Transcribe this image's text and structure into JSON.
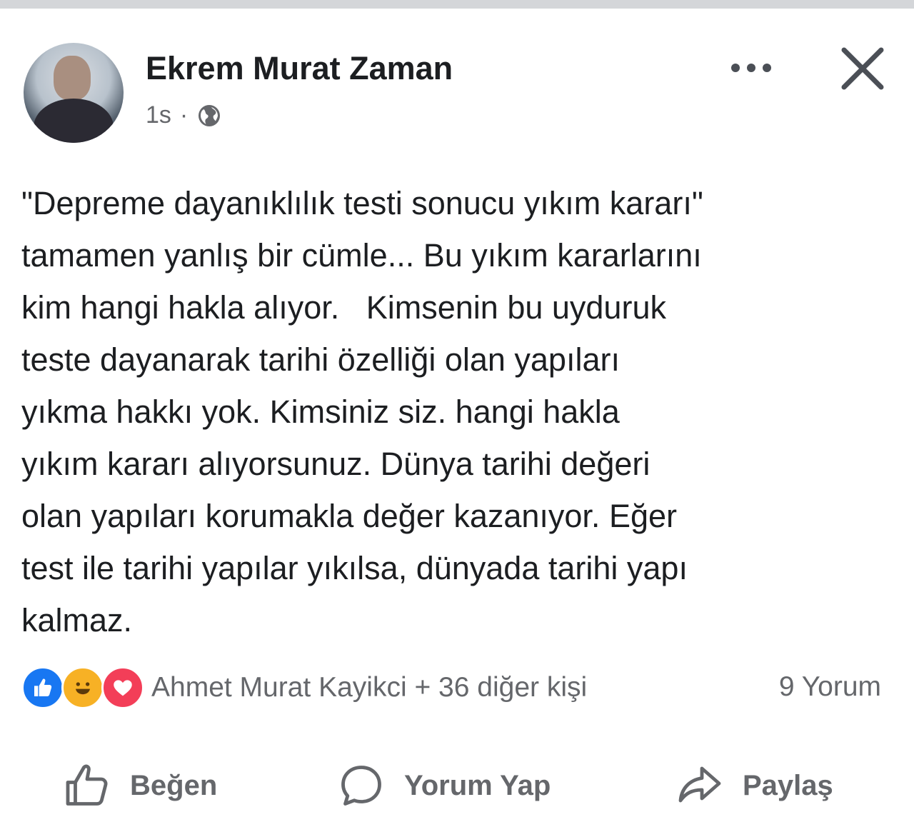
{
  "post": {
    "author": "Ekrem Murat Zaman",
    "time": "1s",
    "separator": "·",
    "text_lines": [
      "\"Depreme dayanıklılık testi sonucu yıkım kararı\"",
      "tamamen yanlış bir cümle... Bu yıkım kararlarını",
      "kim hangi hakla alıyor.   Kimsenin bu uyduruk",
      "teste dayanarak tarihi özelliği olan yapıları",
      "yıkma hakkı yok. Kimsiniz siz. hangi hakla",
      "yıkım kararı alıyorsunuz. Dünya tarihi değeri",
      "olan yapıları korumakla değer kazanıyor. Eğer",
      "test ile tarihi yapılar yıkılsa, dünyada tarihi yapı",
      "kalmaz."
    ]
  },
  "reactions": {
    "icons": [
      "like-icon",
      "haha-icon",
      "love-icon"
    ],
    "summary": "Ahmet Murat Kayikci + 36 diğer kişi",
    "comments": "9 Yorum"
  },
  "actions": {
    "like": "Beğen",
    "comment": "Yorum Yap",
    "share": "Paylaş"
  },
  "colors": {
    "text": "#1c1e21",
    "muted": "#65676b",
    "like_blue": "#1877f2",
    "love_red": "#f33e58",
    "haha_yellow": "#f7b125"
  }
}
